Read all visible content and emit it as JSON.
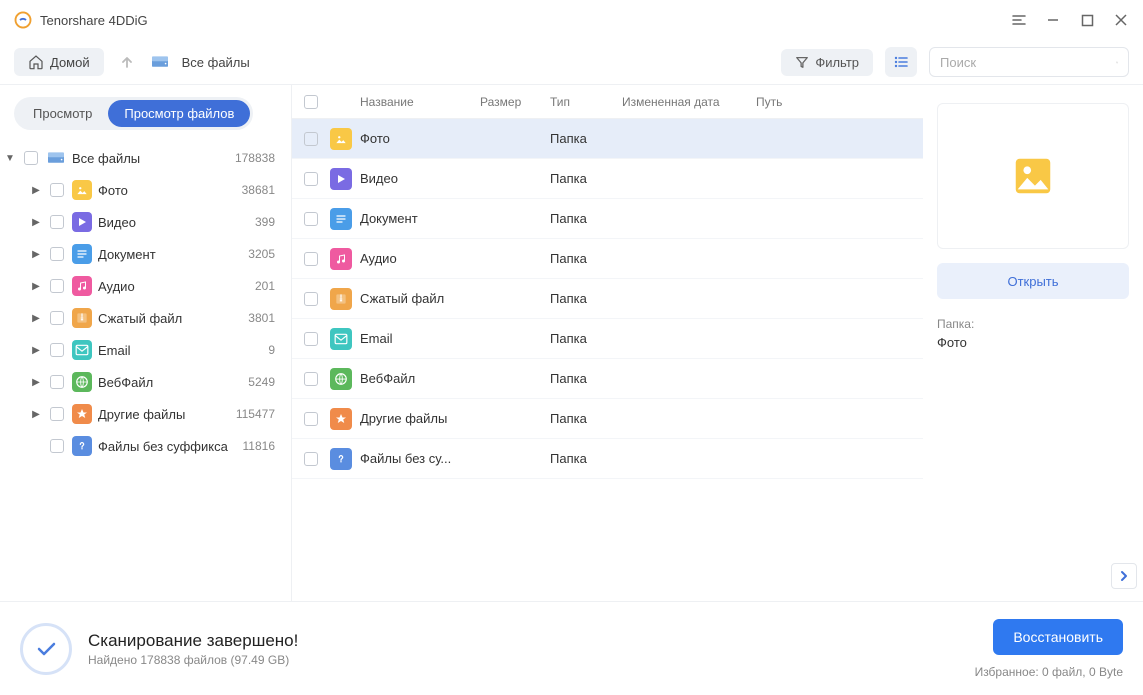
{
  "app": {
    "title": "Tenorshare 4DDiG"
  },
  "toolbar": {
    "home": "Домой",
    "breadcrumb": "Все файлы",
    "filter": "Фильтр",
    "search_placeholder": "Поиск"
  },
  "tabs": {
    "preview": "Просмотр",
    "browse": "Просмотр файлов"
  },
  "tree": {
    "root": {
      "label": "Все файлы",
      "count": "178838"
    },
    "items": [
      {
        "label": "Фото",
        "count": "38681",
        "icon": "photo"
      },
      {
        "label": "Видео",
        "count": "399",
        "icon": "video"
      },
      {
        "label": "Документ",
        "count": "3205",
        "icon": "doc"
      },
      {
        "label": "Аудио",
        "count": "201",
        "icon": "audio"
      },
      {
        "label": "Сжатый файл",
        "count": "3801",
        "icon": "zip"
      },
      {
        "label": "Email",
        "count": "9",
        "icon": "email"
      },
      {
        "label": "ВебФайл",
        "count": "5249",
        "icon": "web"
      },
      {
        "label": "Другие файлы",
        "count": "115477",
        "icon": "other"
      },
      {
        "label": "Файлы без суффикса",
        "count": "11816",
        "icon": "unknown",
        "leaf": true
      }
    ]
  },
  "columns": {
    "name": "Название",
    "size": "Размер",
    "type": "Тип",
    "date": "Измененная дата",
    "path": "Путь"
  },
  "rows": [
    {
      "name": "Фото",
      "type": "Папка",
      "icon": "photo",
      "selected": true
    },
    {
      "name": "Видео",
      "type": "Папка",
      "icon": "video"
    },
    {
      "name": "Документ",
      "type": "Папка",
      "icon": "doc"
    },
    {
      "name": "Аудио",
      "type": "Папка",
      "icon": "audio"
    },
    {
      "name": "Сжатый файл",
      "type": "Папка",
      "icon": "zip"
    },
    {
      "name": "Email",
      "type": "Папка",
      "icon": "email"
    },
    {
      "name": "ВебФайл",
      "type": "Папка",
      "icon": "web"
    },
    {
      "name": "Другие файлы",
      "type": "Папка",
      "icon": "other"
    },
    {
      "name": "Файлы без су...",
      "type": "Папка",
      "icon": "unknown"
    }
  ],
  "details": {
    "open": "Открыть",
    "type_label": "Папка:",
    "type_value": "Фото"
  },
  "footer": {
    "status_main": "Сканирование завершено!",
    "status_sub": "Найдено 178838 файлов (97.49 GB)",
    "recover": "Восстановить",
    "selected": "Избранное: 0 файл, 0 Byte"
  }
}
